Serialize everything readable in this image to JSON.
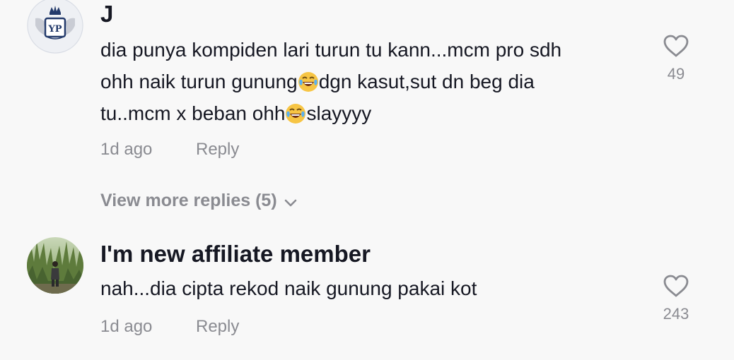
{
  "comments": [
    {
      "username": "J",
      "avatar": "crest-logo-avatar",
      "text_lines": [
        "dia punya kompiden lari turun tu kann...mcm pro sdh",
        "ohh naik turun gunung",
        "dgn kasut,sut dn beg dia",
        "tu..mcm x beban ohh",
        "slayyyy"
      ],
      "emojis": [
        "tears-of-joy-emoji",
        "tears-of-joy-emoji"
      ],
      "time": "1d ago",
      "reply_label": "Reply",
      "likes": "49",
      "like_icon": "heart-outline-icon",
      "view_more": "View more replies (5)"
    },
    {
      "username": "I'm new affiliate member",
      "avatar": "person-in-nature-avatar",
      "text": "nah...dia cipta rekod naik gunung pakai kot",
      "time": "1d ago",
      "reply_label": "Reply",
      "likes": "243",
      "like_icon": "heart-outline-icon"
    }
  ],
  "colors": {
    "background": "#f8f8f8",
    "primary_text": "#161823",
    "secondary_text": "#8a8b91"
  }
}
